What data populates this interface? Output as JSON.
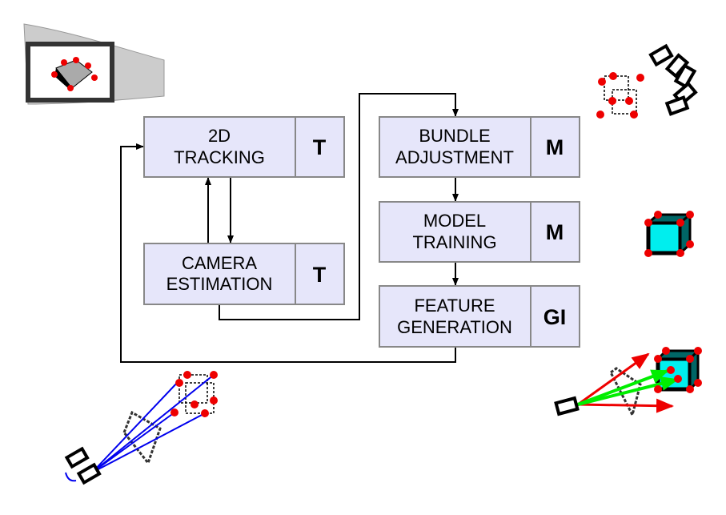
{
  "boxes": {
    "tracking": {
      "line1": "2D",
      "line2": "TRACKING",
      "tag": "T"
    },
    "camera": {
      "line1": "CAMERA",
      "line2": "ESTIMATION",
      "tag": "T"
    },
    "bundle": {
      "line1": "BUNDLE",
      "line2": "ADJUSTMENT",
      "tag": "M"
    },
    "model": {
      "line1": "MODEL",
      "line2": "TRAINING",
      "tag": "M"
    },
    "feature": {
      "line1": "FEATURE",
      "line2": "GENERATION",
      "tag": "GI"
    }
  },
  "colors": {
    "box_fill": "#e6e6fa",
    "box_stroke": "#888888",
    "point": "#ee0000",
    "cube": "#00ffff",
    "ray_blue": "#0000ee",
    "ray_green": "#00ee00",
    "ray_red": "#ee0000"
  }
}
